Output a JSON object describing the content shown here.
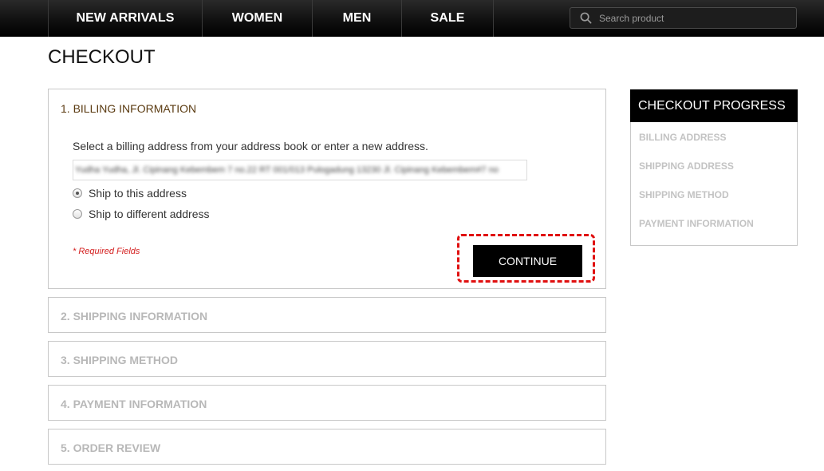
{
  "nav": {
    "items": [
      "NEW ARRIVALS",
      "WOMEN",
      "MEN",
      "SALE"
    ],
    "search_placeholder": "Search product"
  },
  "page": {
    "title": "CHECKOUT"
  },
  "billing": {
    "heading": "1. BILLING INFORMATION",
    "instruction": "Select a billing address from your address book or enter a new address.",
    "address_value": "Yudha Yudha, Jl. Cipinang Kebembem 7 no.22 RT 001/013 Pulogadung 13230 Jl. Cipinang Kebembem#7 no",
    "ship_options": [
      {
        "label": "Ship to this address",
        "selected": true
      },
      {
        "label": "Ship to different address",
        "selected": false
      }
    ],
    "required_note": "* Required Fields",
    "continue_label": "CONTINUE"
  },
  "sections": [
    "2. SHIPPING INFORMATION",
    "3. SHIPPING METHOD",
    "4. PAYMENT INFORMATION",
    "5. ORDER REVIEW"
  ],
  "progress": {
    "title": "CHECKOUT PROGRESS",
    "items": [
      "BILLING ADDRESS",
      "SHIPPING ADDRESS",
      "SHIPPING METHOD",
      "PAYMENT INFORMATION"
    ]
  },
  "colors": {
    "active_heading": "#5a3a10",
    "inactive_heading": "#b8b8b8",
    "required": "#d42020",
    "highlight": "#e01010"
  },
  "icons": {
    "search": "search-icon"
  }
}
